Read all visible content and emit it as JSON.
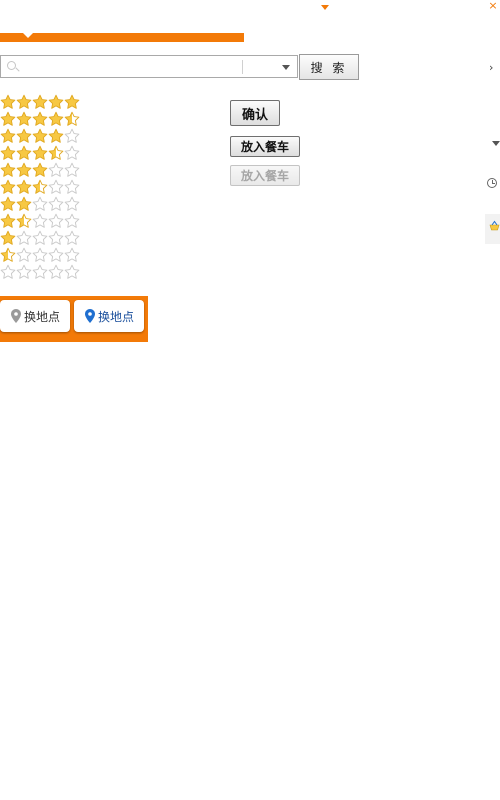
{
  "search": {
    "placeholder": "",
    "button_label": "搜 索"
  },
  "ratings": [
    {
      "value": 5.0
    },
    {
      "value": 4.5
    },
    {
      "value": 4.0
    },
    {
      "value": 3.5
    },
    {
      "value": 3.0
    },
    {
      "value": 2.5
    },
    {
      "value": 2.0
    },
    {
      "value": 1.5
    },
    {
      "value": 1.0
    },
    {
      "value": 0.5
    },
    {
      "value": 0.0
    }
  ],
  "buttons": {
    "confirm_label": "确认",
    "add_to_cart_label": "放入餐车",
    "add_to_cart_disabled_label": "放入餐车"
  },
  "location_tabs": [
    {
      "label": "换地点",
      "state": "normal",
      "icon": "map-pin-icon"
    },
    {
      "label": "换地点",
      "state": "active",
      "icon": "map-pin-icon"
    }
  ],
  "colors": {
    "accent": "#f37a08",
    "star_filled": "#f7c843",
    "star_empty": "#ffffff",
    "pin_inactive": "#9a9a9a",
    "pin_active": "#1f6fd0"
  }
}
